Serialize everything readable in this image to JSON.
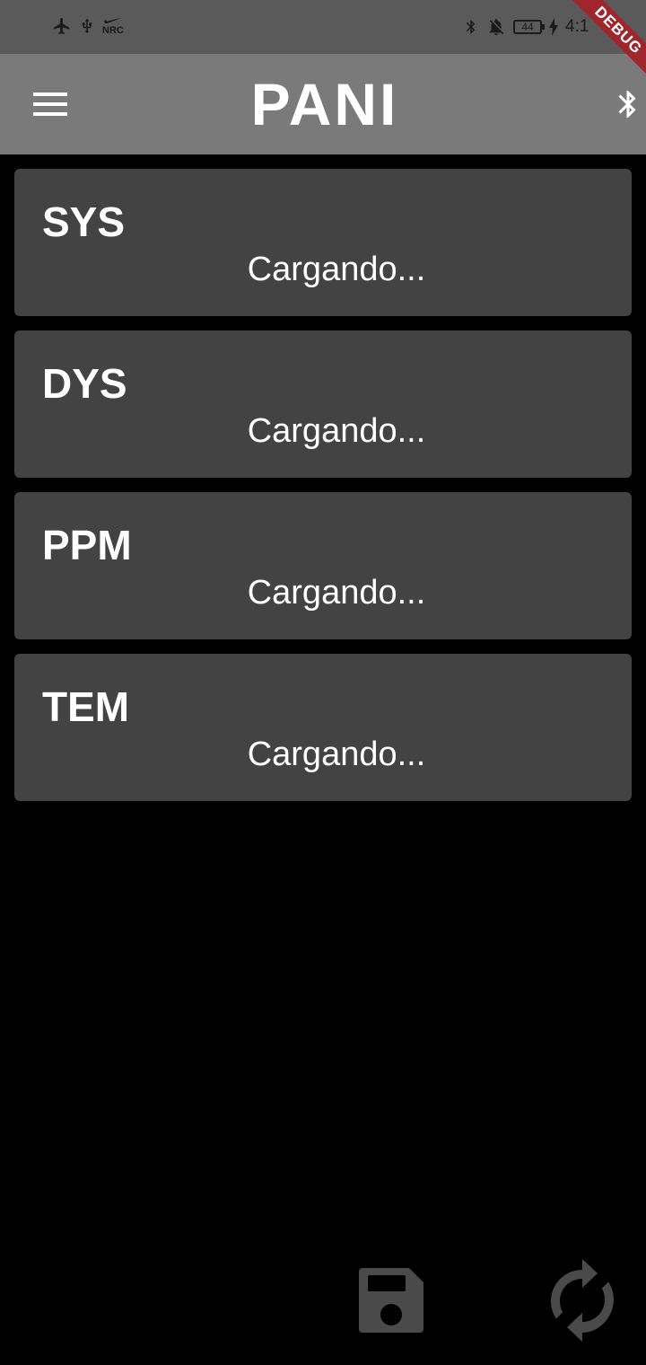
{
  "status_bar": {
    "left_icons": [
      "airplane-icon",
      "usb-icon",
      "nike-icon"
    ],
    "nrc_label": "NRC",
    "right_icons": [
      "bluetooth-icon",
      "notifications-off-icon",
      "battery-icon",
      "charging-icon"
    ],
    "battery_level": "44",
    "clock": "4:1"
  },
  "app_bar": {
    "title": "PANI",
    "menu_icon": "hamburger-menu-icon",
    "bluetooth_icon": "bluetooth-icon"
  },
  "cards": [
    {
      "label": "SYS",
      "value": "Cargando..."
    },
    {
      "label": "DYS",
      "value": "Cargando..."
    },
    {
      "label": "PPM",
      "value": "Cargando..."
    },
    {
      "label": "TEM",
      "value": "Cargando..."
    }
  ],
  "actions": {
    "save_icon": "floppy-disk-icon",
    "refresh_icon": "refresh-icon"
  },
  "debug_banner": "DEBUG",
  "colors": {
    "background": "#000000",
    "status_bar": "#5a5a5a",
    "app_bar": "#7a7a7a",
    "card": "#434343",
    "action_icon": "#4a4a4a",
    "debug_banner": "#a0262e"
  }
}
